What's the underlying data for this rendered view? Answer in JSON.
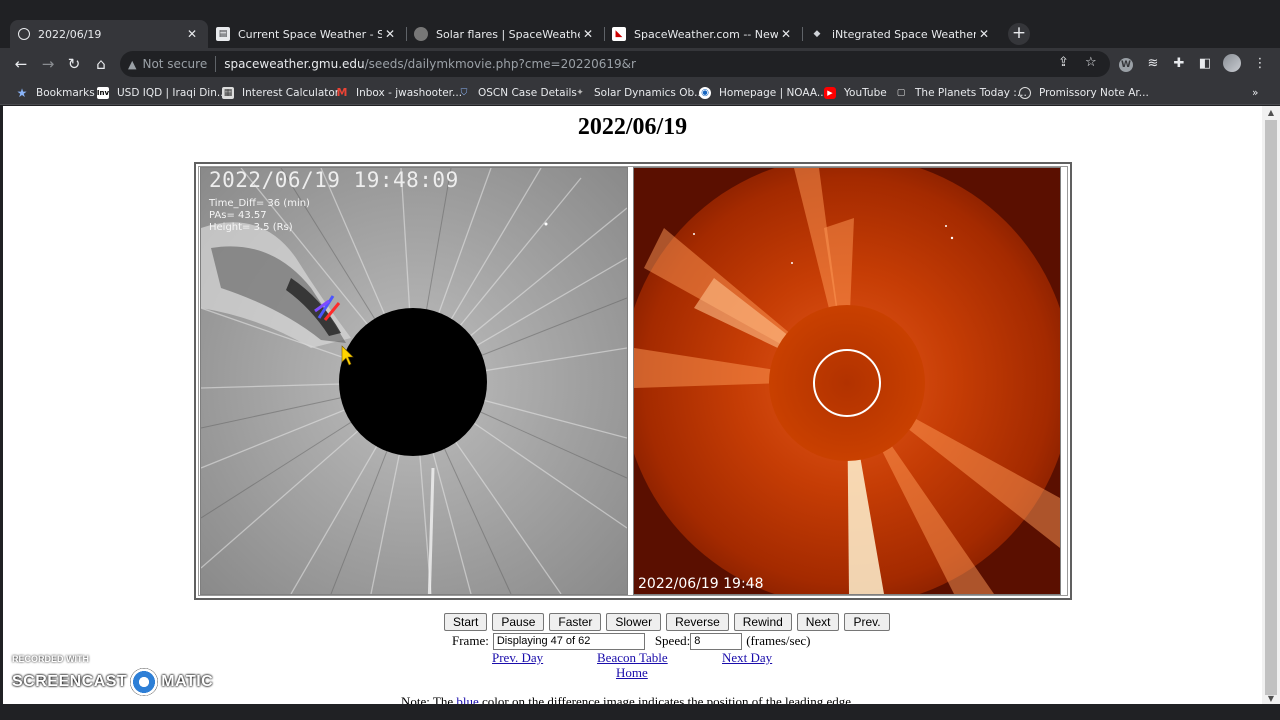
{
  "browser": {
    "tabs": [
      {
        "title": "2022/06/19",
        "active": true,
        "icon": "globe-icon"
      },
      {
        "title": "Current Space Weather - Space W",
        "active": false,
        "icon": "doc-icon"
      },
      {
        "title": "Solar flares | SpaceWeatherLive.c",
        "active": false,
        "icon": "sun-icon"
      },
      {
        "title": "SpaceWeather.com -- News and",
        "active": false,
        "icon": "sw-icon"
      },
      {
        "title": "iNtegrated Space Weather Analy",
        "active": false,
        "icon": "nasa-icon"
      }
    ],
    "close_glyph": "✕",
    "newtab_glyph": "+",
    "address": {
      "security": "Not secure",
      "host": "spaceweather.gmu.edu",
      "path": "/seeds/dailymkmovie.php?cme=20220619&r"
    },
    "bookmarks": [
      {
        "label": "Bookmarks",
        "icon": "star-icon"
      },
      {
        "label": "USD IQD | Iraqi Din...",
        "icon": "inv-icon"
      },
      {
        "label": "Interest Calculator",
        "icon": "calc-icon"
      },
      {
        "label": "Inbox - jwashooter...",
        "icon": "gmail-icon"
      },
      {
        "label": "OSCN Case Details",
        "icon": "shield-icon"
      },
      {
        "label": "Solar Dynamics Ob...",
        "icon": "sdo-icon"
      },
      {
        "label": "Homepage | NOAA...",
        "icon": "noaa-icon"
      },
      {
        "label": "YouTube",
        "icon": "youtube-icon"
      },
      {
        "label": "The Planets Today :...",
        "icon": "planet-icon"
      },
      {
        "label": "Promissory Note Ar...",
        "icon": "globe-icon"
      }
    ]
  },
  "page": {
    "title": "2022/06/19",
    "left_image": {
      "timestamp": "2022/06/19 19:48:09",
      "time_diff": "Time_Diff= 36 (min)",
      "pas": "PAs= 43.57",
      "height": "Height= 3.5 (Rs)"
    },
    "right_image": {
      "timestamp": "2022/06/19 19:48"
    },
    "controls": [
      "Start",
      "Pause",
      "Faster",
      "Slower",
      "Reverse",
      "Rewind",
      "Next",
      "Prev."
    ],
    "frame_label": "Frame:",
    "frame_value": "Displaying 47 of 62",
    "speed_label": "Speed:",
    "speed_value": "8",
    "speed_unit": "(frames/sec)",
    "links": {
      "prev_day": "Prev. Day",
      "beacon_table": "Beacon Table",
      "home": "Home",
      "next_day": "Next Day"
    },
    "note_prefix": "Note: The ",
    "note_blue": "blue",
    "note_suffix": " color on the difference image indicates the position of the leading edge."
  },
  "watermark": {
    "recorded_with": "RECORDED WITH",
    "brand_left": "SCREENCAST",
    "brand_right": "MATIC"
  },
  "colors": {
    "chrome_bg": "#202124",
    "toolbar_bg": "#35363a",
    "link": "#1a0dab",
    "corona_orange": "#c43a00"
  }
}
